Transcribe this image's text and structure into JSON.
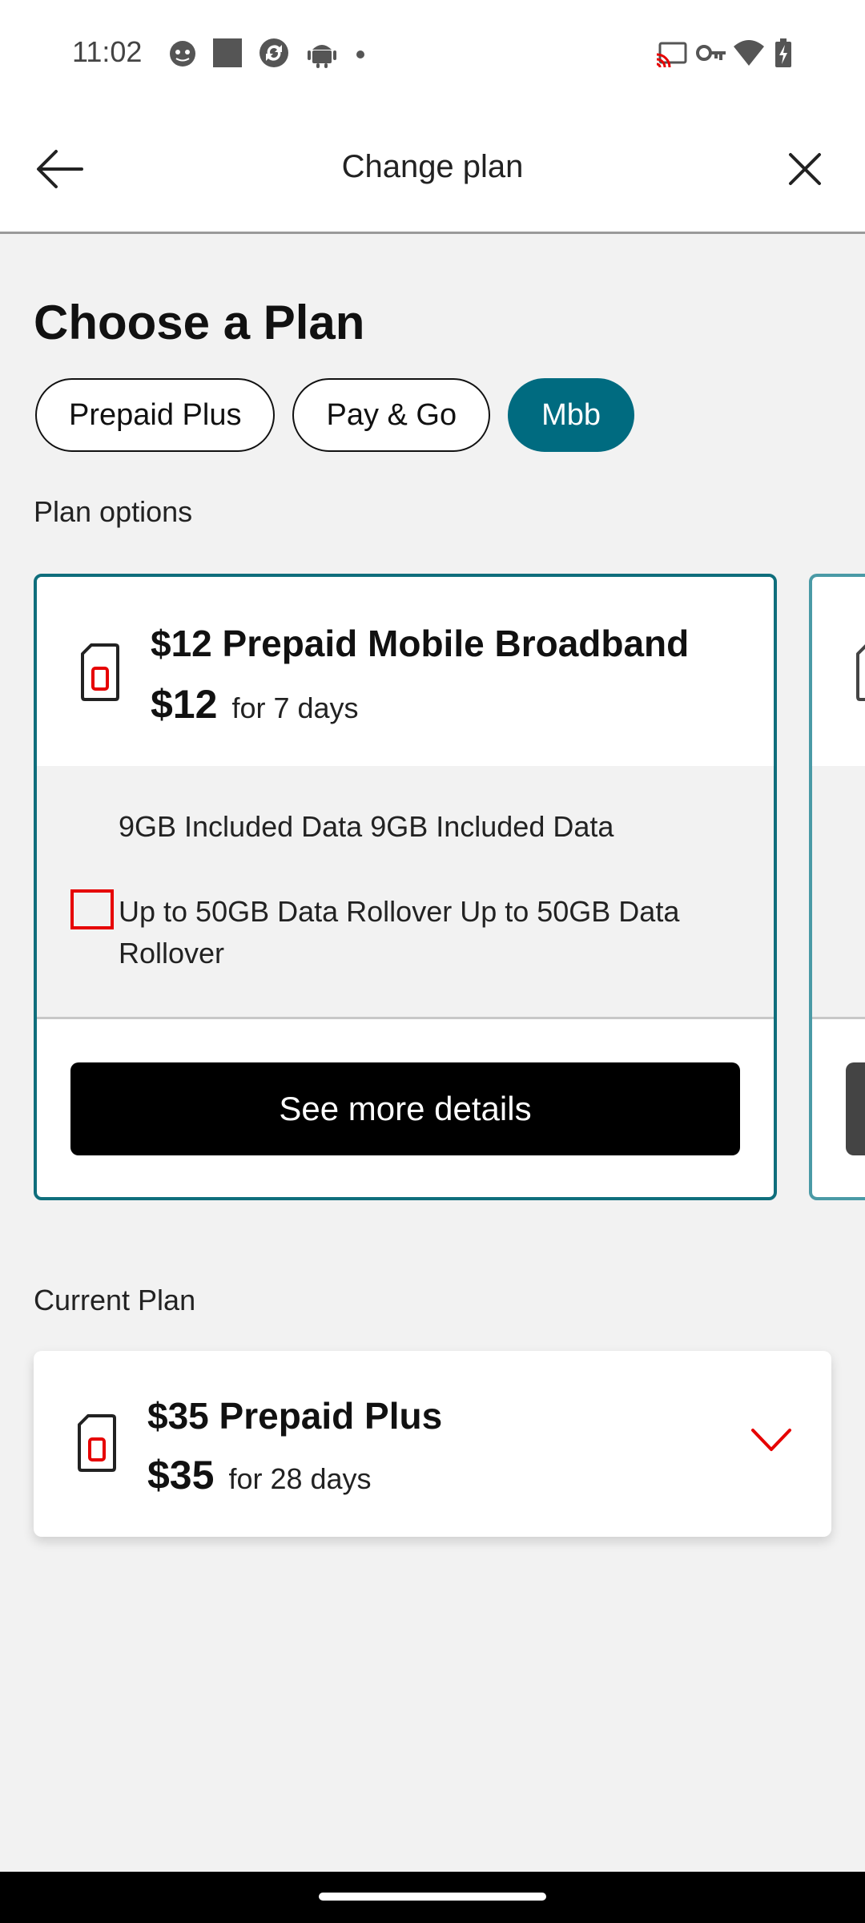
{
  "status_bar": {
    "time": "11:02",
    "left_icons": [
      "cat-face-icon",
      "square-icon",
      "sync-icon",
      "android-icon",
      "dot-icon"
    ],
    "right_icons": [
      "cast-icon",
      "key-icon",
      "wifi-icon",
      "battery-charging-icon"
    ]
  },
  "header": {
    "title": "Change plan",
    "back_icon": "arrow-left-icon",
    "close_icon": "close-icon"
  },
  "page": {
    "title": "Choose a Plan",
    "tabs": [
      {
        "label": "Prepaid Plus",
        "active": false
      },
      {
        "label": "Pay & Go",
        "active": false
      },
      {
        "label": "Mbb",
        "active": true
      }
    ],
    "plan_options_label": "Plan options",
    "current_plan_label": "Current Plan"
  },
  "plans": [
    {
      "name": "$12 Prepaid Mobile Broadband",
      "price": "$12",
      "period": "for 7 days",
      "features": [
        "9GB Included Data 9GB Included Data",
        "Up to 50GB  Data Rollover Up to 50GB  Data Rollover"
      ],
      "details_label": "See more details"
    }
  ],
  "current_plan": {
    "name": "$35 Prepaid Plus",
    "price": "$35",
    "period": "for 28 days",
    "expand_icon": "chevron-down-icon"
  },
  "colors": {
    "accent_teal": "#006b80",
    "card_border": "#0f6e7c",
    "brand_red": "#e60000",
    "button_black": "#000000",
    "background": "#f2f2f2"
  }
}
